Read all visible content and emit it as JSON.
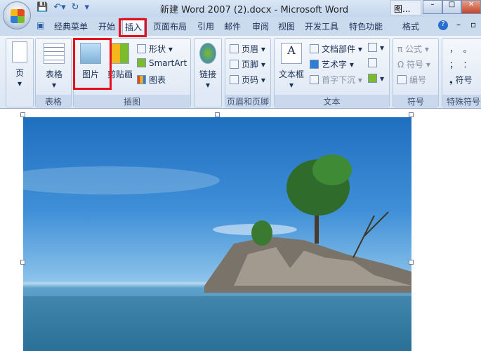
{
  "window": {
    "title": "新建 Word 2007 (2).docx - Microsoft Word",
    "taskbar_item": "图...",
    "minimize": "–",
    "maximize": "□",
    "close": "✕"
  },
  "tabs": [
    "经典菜单",
    "开始",
    "插入",
    "页面布局",
    "引用",
    "邮件",
    "审阅",
    "视图",
    "开发工具",
    "特色功能",
    "格式"
  ],
  "active_tab": "插入",
  "ribbon": {
    "page": {
      "label": "页"
    },
    "table": {
      "button": "表格",
      "group": "表格"
    },
    "illustrations": {
      "picture": "图片",
      "clipart": "剪贴画",
      "shapes": "形状",
      "smartart": "SmartArt",
      "chart": "图表",
      "group": "插图"
    },
    "links": {
      "button": "链接"
    },
    "header_footer": {
      "header": "页眉",
      "footer": "页脚",
      "page_number": "页码",
      "group": "页眉和页脚"
    },
    "text": {
      "textbox": "文本框",
      "quickparts": "文档部件",
      "wordart": "艺术字",
      "dropcap": "首字下沉",
      "group": "文本"
    },
    "symbols": {
      "equation": "公式",
      "symbol": "符号",
      "numbering": "编号",
      "group": "符号"
    },
    "special": {
      "symbol": "符号",
      "group": "特殊符号"
    }
  },
  "colors": {
    "highlight": "#e5101c",
    "ribbon": "#dbe6f4"
  }
}
